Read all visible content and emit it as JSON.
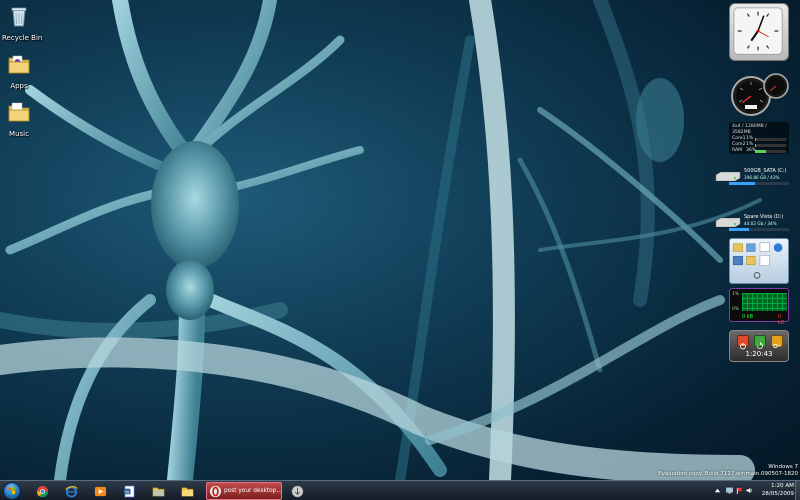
{
  "desktop": {
    "icons": [
      {
        "label": "Recycle Bin",
        "icon": "recycle-bin-icon"
      },
      {
        "label": "Apps",
        "icon": "folder-icon"
      },
      {
        "label": "Music",
        "icon": "folder-icon"
      }
    ]
  },
  "gadgets": {
    "sysinfo": {
      "header": "4x4 / 1280MB / 3582MB",
      "rows": [
        {
          "name": "Core1",
          "value": "1%",
          "fill": 0.01
        },
        {
          "name": "Core2",
          "value": "1%",
          "fill": 0.01
        },
        {
          "name": "RAM",
          "value": "36%",
          "fill": 0.36
        }
      ]
    },
    "drive_c": {
      "title": "500GB_SATA (C:)",
      "sub": "196.86 GB / 43%",
      "used_fraction": 0.43
    },
    "drive_d": {
      "title": "Spare Vista (D:)",
      "sub": "44.02 Gb / 34%",
      "used_fraction": 0.34
    },
    "cpu_meter": {
      "top_label": "1%",
      "bottom_label": "0%",
      "value_left": "0 kB",
      "value_right": "0 kB"
    },
    "power": {
      "time": "1:20:43"
    }
  },
  "watermark": {
    "line1": "Windows 7",
    "line2": "Evaluation copy. Build 7127.winmain.090507-1820"
  },
  "taskbar": {
    "start_icon": "windows-start-icon",
    "pinned": [
      "chrome-icon",
      "internet-explorer-icon",
      "media-player-icon",
      "word-icon",
      "explorer-icon",
      "folder-icon"
    ],
    "active_task": {
      "label": "post your desktop...",
      "icon": "opera-icon"
    },
    "clock": {
      "time": "1:20 AM",
      "date": "28/05/2009"
    }
  },
  "colors": {
    "accent": "#3aa0ff",
    "taskbar": "#1b2533"
  }
}
